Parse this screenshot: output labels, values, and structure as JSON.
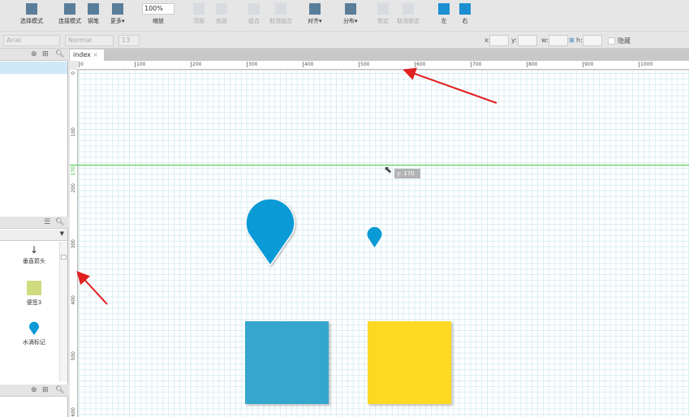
{
  "toolbar": {
    "items": [
      {
        "label": "选择模式",
        "icon": "select-mode-icon"
      },
      {
        "label": "连接模式",
        "icon": "connect-mode-icon"
      },
      {
        "label": "钢笔",
        "icon": "pen-icon"
      },
      {
        "label": "更多▾",
        "icon": "more-icon"
      },
      {
        "label": "缩放",
        "icon": "zoom-icon"
      },
      {
        "label": "顶层",
        "icon": "bring-front-icon"
      },
      {
        "label": "底层",
        "icon": "send-back-icon"
      },
      {
        "label": "组合",
        "icon": "group-icon"
      },
      {
        "label": "取消组合",
        "icon": "ungroup-icon"
      },
      {
        "label": "对齐▾",
        "icon": "align-icon"
      },
      {
        "label": "分布▾",
        "icon": "distribute-icon"
      },
      {
        "label": "锁定",
        "icon": "lock-icon"
      },
      {
        "label": "取消锁定",
        "icon": "unlock-icon"
      },
      {
        "label": "左",
        "icon": "left-panel-icon"
      },
      {
        "label": "右",
        "icon": "right-panel-icon"
      }
    ],
    "zoom_value": "100%"
  },
  "format": {
    "font": "Arial",
    "style": "Normal",
    "size": "13",
    "x_label": "x:",
    "y_label": "y:",
    "w_label": "w:",
    "h_label": "h:",
    "hidden_label": "隐藏"
  },
  "tab": {
    "label": "index",
    "close": "×"
  },
  "ruler": {
    "h": [
      "0",
      "100",
      "200",
      "300",
      "400",
      "500",
      "600",
      "700",
      "800",
      "900",
      "1000"
    ],
    "v": [
      "0",
      "100",
      "170",
      "200",
      "300",
      "400",
      "500",
      "600"
    ]
  },
  "guide": {
    "tooltip": "y: 170",
    "color": "#3fd13f"
  },
  "library": {
    "items": [
      {
        "label": "垂直箭头"
      },
      {
        "label": "便签3"
      },
      {
        "label": "水滴标记"
      }
    ]
  },
  "colors": {
    "blue": "#0a9ad6",
    "square_blue": "#35a7cf",
    "square_yellow": "#fdd924",
    "arrow": "#e02020"
  }
}
